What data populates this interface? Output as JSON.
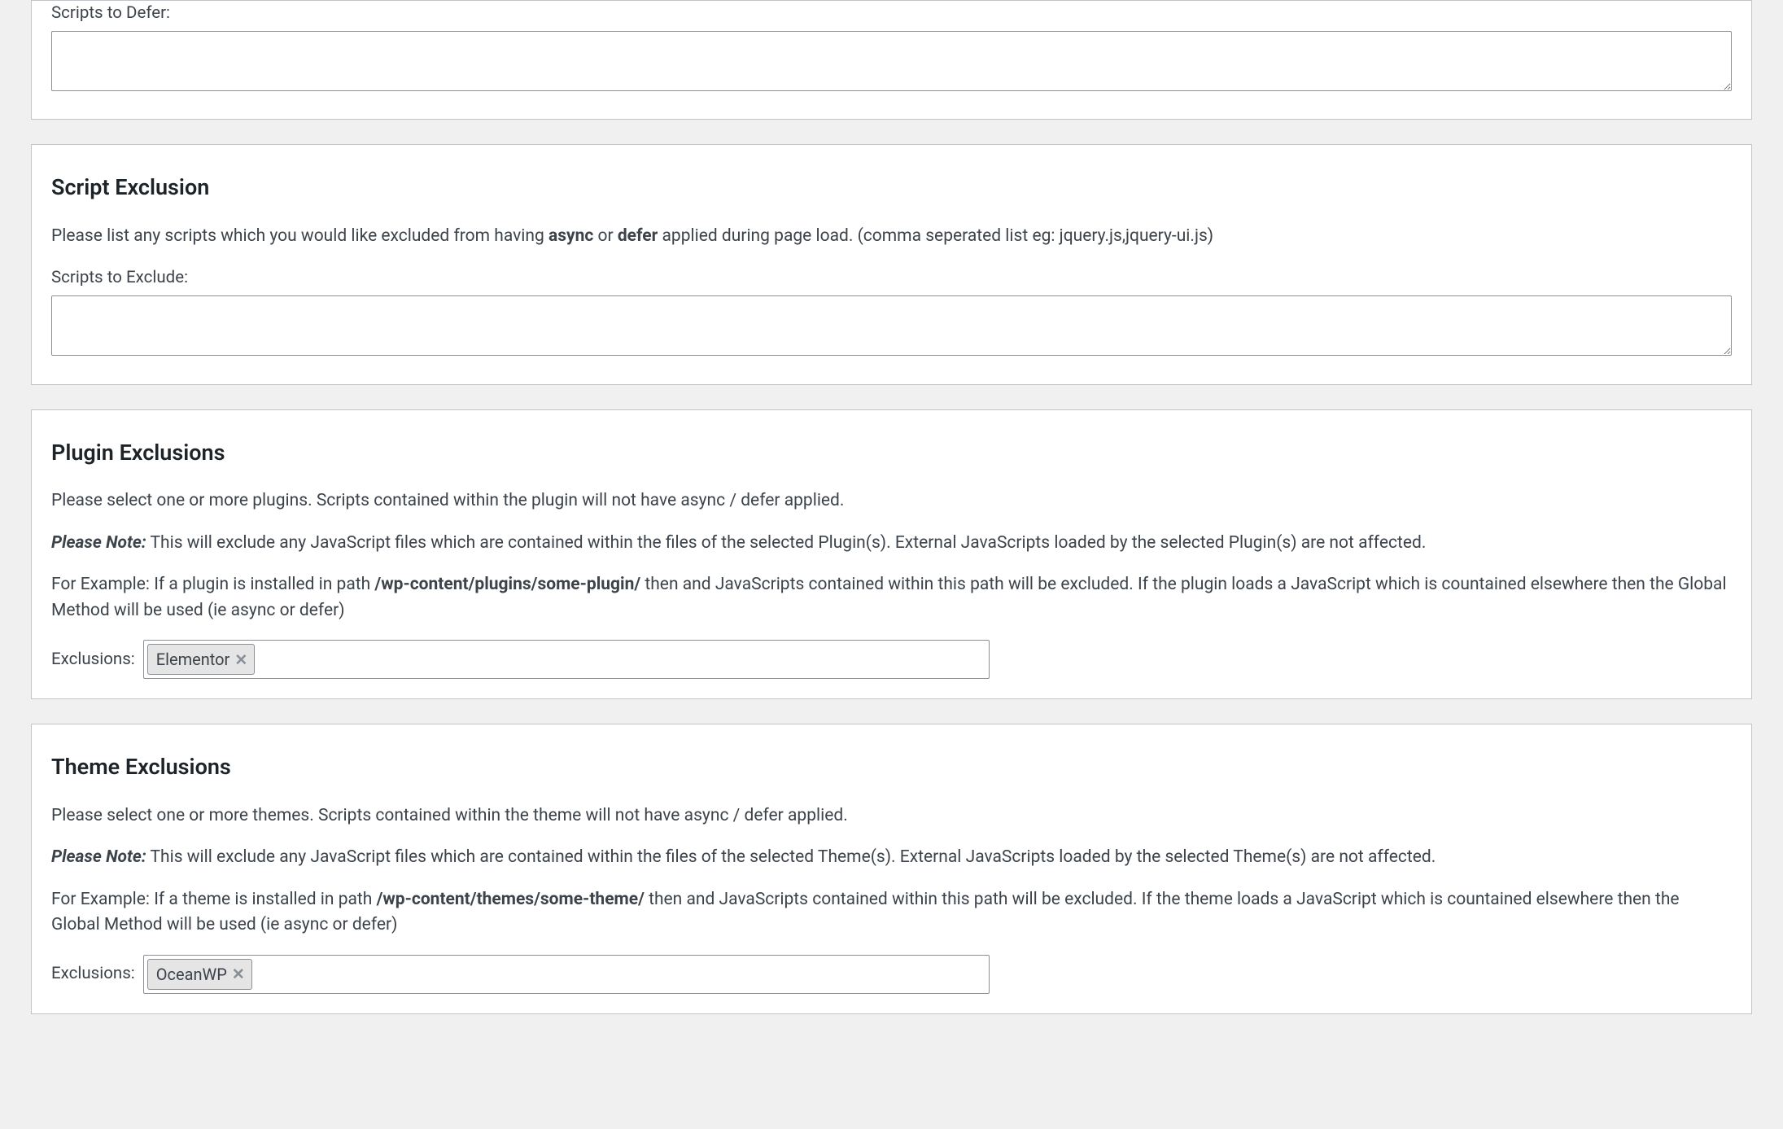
{
  "defer_panel": {
    "label": "Scripts to Defer:"
  },
  "exclusion_panel": {
    "heading": "Script Exclusion",
    "desc_pre": "Please list any scripts which you would like excluded from having ",
    "b1": "async",
    "desc_or": " or ",
    "b2": "defer",
    "desc_post": " applied during page load. (comma seperated list eg: jquery.js,jquery-ui.js)",
    "label": "Scripts to Exclude:"
  },
  "plugin_panel": {
    "heading": "Plugin Exclusions",
    "p1": "Please select one or more plugins. Scripts contained within the plugin will not have async / defer applied.",
    "note_label": "Please Note:",
    "note_text": " This will exclude any JavaScript files which are contained within the files of the selected Plugin(s). External JavaScripts loaded by the selected Plugin(s) are not affected.",
    "ex_pre": "For Example: If a plugin is installed in path ",
    "ex_path": "/wp-content/plugins/some-plugin/",
    "ex_post": " then and JavaScripts contained within this path will be excluded. If the plugin loads a JavaScript which is countained elsewhere then the Global Method will be used (ie async or defer)",
    "exclusions_label": "Exclusions:",
    "token": "Elementor"
  },
  "theme_panel": {
    "heading": "Theme Exclusions",
    "p1": "Please select one or more themes. Scripts contained within the theme will not have async / defer applied.",
    "note_label": "Please Note:",
    "note_text": " This will exclude any JavaScript files which are contained within the files of the selected Theme(s). External JavaScripts loaded by the selected Theme(s) are not affected.",
    "ex_pre": "For Example: If a theme is installed in path ",
    "ex_path": "/wp-content/themes/some-theme/",
    "ex_post": " then and JavaScripts contained within this path will be excluded. If the theme loads a JavaScript which is countained elsewhere then the Global Method will be used (ie async or defer)",
    "exclusions_label": "Exclusions:",
    "token": "OceanWP"
  }
}
